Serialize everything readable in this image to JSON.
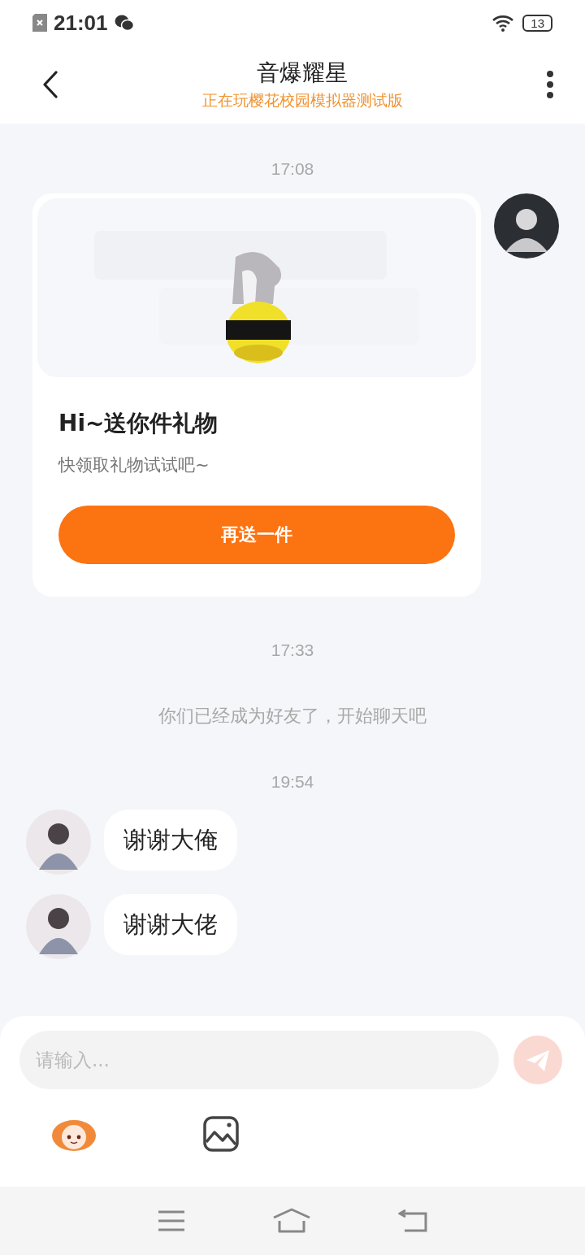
{
  "status_bar": {
    "time": "21:01",
    "battery": "13"
  },
  "header": {
    "title": "音爆耀星",
    "subtitle": "正在玩樱花校园模拟器测试版"
  },
  "messages": [
    {
      "kind": "time",
      "text": "17:08"
    },
    {
      "kind": "gift",
      "outgoing": true,
      "title": "Hi~送你件礼物",
      "text": "快领取礼物试试吧~",
      "button": "再送一件"
    },
    {
      "kind": "time",
      "text": "17:33"
    },
    {
      "kind": "system",
      "text": "你们已经成为好友了，开始聊天吧"
    },
    {
      "kind": "time",
      "text": "19:54"
    },
    {
      "kind": "text",
      "outgoing": false,
      "text": "谢谢大俺"
    },
    {
      "kind": "text",
      "outgoing": false,
      "text": "谢谢大佬"
    }
  ],
  "input": {
    "placeholder": "请输入..."
  }
}
